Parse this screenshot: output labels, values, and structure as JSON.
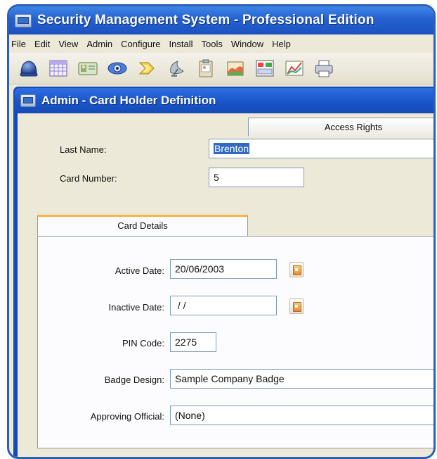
{
  "window": {
    "title": "Security Management System - Professional Edition"
  },
  "menu": [
    "File",
    "Edit",
    "View",
    "Admin",
    "Configure",
    "Install",
    "Tools",
    "Window",
    "Help"
  ],
  "toolbar": {
    "icons": [
      "helmet-icon",
      "grid-icon",
      "card-icon",
      "eye-icon",
      "lightning-icon",
      "satellite-icon",
      "clipboard-icon",
      "book-icon",
      "layout-icon",
      "chart-icon",
      "printer-icon"
    ]
  },
  "child_window": {
    "title": "Admin - Card Holder Definition"
  },
  "form": {
    "last_name_label": "Last Name:",
    "last_name_value": "Brenton",
    "card_number_label": "Card Number:",
    "card_number_value": "5"
  },
  "tabs": {
    "card_details": "Card Details",
    "access_rights": "Access Rights"
  },
  "details": {
    "active_date_label": "Active Date:",
    "active_date_value": "20/06/2003",
    "inactive_date_label": "Inactive Date:",
    "inactive_date_value": " / /",
    "pin_label": "PIN Code:",
    "pin_value": "2275",
    "badge_label": "Badge Design:",
    "badge_value": "Sample Company Badge",
    "official_label": "Approving Official:",
    "official_value": "(None)"
  }
}
